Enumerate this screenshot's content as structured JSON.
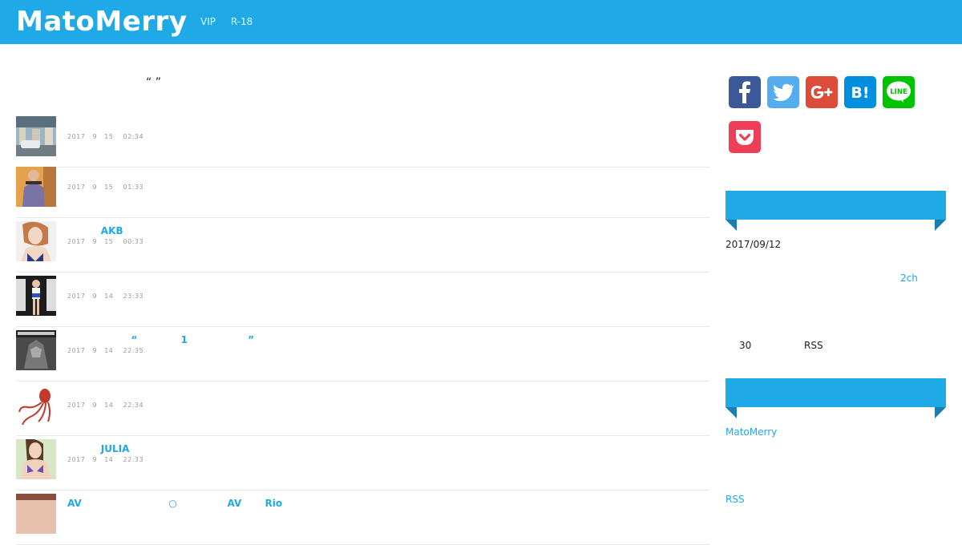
{
  "header": {
    "logo": "MatoMerry",
    "nav": [
      "VIP",
      "R-18"
    ]
  },
  "main": {
    "heading": "“          ”",
    "posts": [
      {
        "title": "",
        "meta": "2017   9   15    02:34"
      },
      {
        "title": "",
        "meta": "2017   9   15    01:33"
      },
      {
        "title": "          AKB",
        "meta": "2017   9   15    00:33"
      },
      {
        "title": "",
        "meta": "2017   9   14    23:33"
      },
      {
        "title": "                   “             1                  ”",
        "meta": "2017   9   14    22:35"
      },
      {
        "title": "",
        "meta": "2017   9   14    22:34"
      },
      {
        "title": "          JULIA",
        "meta": "2017   9   14    22:33"
      },
      {
        "title": "AV                          ○               AV       Rio",
        "meta": ""
      }
    ]
  },
  "side": {
    "share_icons": [
      "facebook-icon",
      "twitter-icon",
      "google-plus-icon",
      "hatena-bookmark-icon",
      "line-icon",
      "pocket-icon"
    ],
    "line_label": "LINE",
    "hatena_label": "B!",
    "date": "2017/09/12",
    "link_2ch": "2ch",
    "info_num": "30",
    "info_rss": "RSS",
    "site_link": "MatoMerry",
    "rss_link": "RSS"
  },
  "colors": {
    "brand": "#1fa9e6",
    "facebook": "#3b5998",
    "twitter": "#55acee",
    "googleplus": "#dd4b39",
    "hatena": "#008fde",
    "line": "#00c300",
    "pocket": "#ef3f56"
  }
}
